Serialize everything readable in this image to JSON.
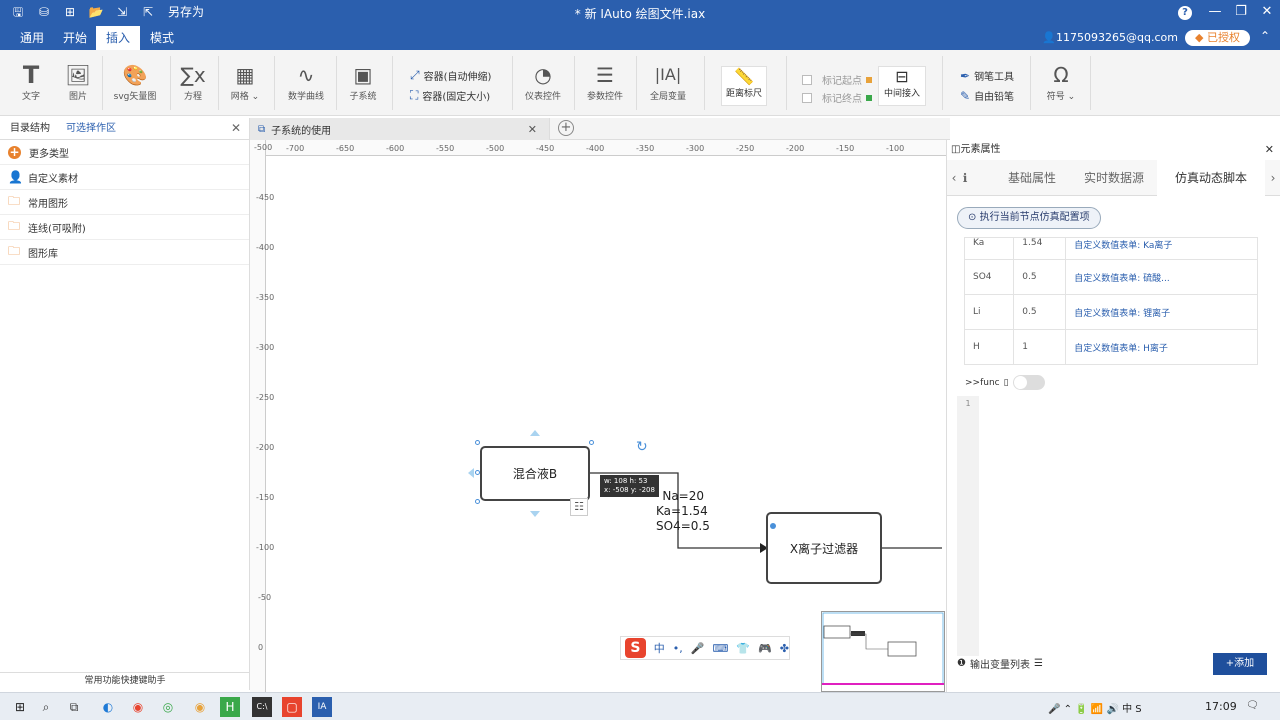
{
  "titlebar": {
    "title": "* 新 IAuto 绘图文件.iax",
    "save_as": "另存为",
    "help": "?"
  },
  "menubar": {
    "items": [
      "通用",
      "开始",
      "插入",
      "模式"
    ],
    "active": "插入",
    "user": "1175093265@qq.com",
    "auth": "已授权"
  },
  "ribbon": {
    "text": "文字",
    "image": "图片",
    "svg": "svg矢量图",
    "equation": "方程",
    "grid": "网格",
    "curve": "数学曲线",
    "subsystem": "子系统",
    "container_auto": "容器(自动伸缩)",
    "container_fixed": "容器(固定大小)",
    "gauge": "仪表控件",
    "param": "参数控件",
    "globalvar": "全局变量",
    "distance": "距离标尺",
    "mark_start": "标记起点",
    "mark_end": "标记终点",
    "mid_access": "中间接入",
    "pen": "钢笔工具",
    "pencil": "自由铅笔",
    "symbol": "符号"
  },
  "left_panel": {
    "tabs": [
      "目录结构",
      "可选择作区"
    ],
    "items": [
      "更多类型",
      "自定义素材",
      "常用图形",
      "连线(可吸附)",
      "图形库"
    ],
    "footer": "常用功能快捷键助手"
  },
  "doc_tab": {
    "label": "子系统的使用"
  },
  "ruler_h": [
    "-700",
    "-650",
    "-600",
    "-550",
    "-500",
    "-450",
    "-400",
    "-350",
    "-300",
    "-250",
    "-200",
    "-150",
    "-100"
  ],
  "ruler_v": [
    "-500",
    "-450",
    "-400",
    "-350",
    "-300",
    "-250",
    "-200",
    "-150",
    "-100",
    "-50",
    "0"
  ],
  "canvas": {
    "nodeA": "混合液B",
    "nodeB": "X离子过滤器",
    "size_tip": "w: 108  h: 53",
    "pos_tip": "x: -508  y: -208",
    "flow_lines": [
      "Na=20",
      "Ka=1.54",
      "SO4=0.5"
    ]
  },
  "ime": {
    "lang": "中",
    "punct": "•,"
  },
  "right_panel": {
    "title": "元素属性",
    "tabs": [
      "基础属性",
      "实时数据源",
      "仿真动态脚本"
    ],
    "active_tab": "仿真动态脚本",
    "exec_btn": "执行当前节点仿真配置项",
    "rows": [
      {
        "name": "Ka",
        "value": "1.54",
        "link": "自定义数值表单: Ka离子"
      },
      {
        "name": "SO4",
        "value": "0.5",
        "link": "自定义数值表单: 硫酸..."
      },
      {
        "name": "Li",
        "value": "0.5",
        "link": "自定义数值表单: 锂离子"
      },
      {
        "name": "H",
        "value": "1",
        "link": "自定义数值表单: H离子"
      }
    ],
    "func_label": ">>func",
    "line_no": "1",
    "output_label": "输出变量列表",
    "add_btn": "+添加"
  },
  "taskbar": {
    "time": "17:09"
  }
}
